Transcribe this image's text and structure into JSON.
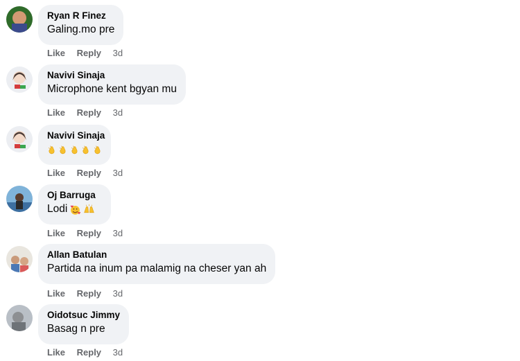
{
  "comments": [
    {
      "name": "Ryan R Finez",
      "text": "Galing.mo pre",
      "actions": {
        "like": "Like",
        "reply": "Reply",
        "time": "3d"
      }
    },
    {
      "name": "Navivi Sinaja",
      "text": "Microphone kent bgyan mu",
      "actions": {
        "like": "Like",
        "reply": "Reply",
        "time": "3d"
      }
    },
    {
      "name": "Navivi Sinaja",
      "text": "",
      "emoji": [
        "clapping-hands",
        "clapping-hands",
        "clapping-hands",
        "clapping-hands",
        "clapping-hands"
      ],
      "actions": {
        "like": "Like",
        "reply": "Reply",
        "time": "3d"
      }
    },
    {
      "name": "Oj Barruga",
      "text": "Lodi",
      "emoji": [
        "smiling-face-with-hearts",
        "raising-hands"
      ],
      "actions": {
        "like": "Like",
        "reply": "Reply",
        "time": "3d"
      }
    },
    {
      "name": "Allan Batulan",
      "text": "Partida na inum pa malamig na cheser yan ah",
      "actions": {
        "like": "Like",
        "reply": "Reply",
        "time": "3d"
      }
    },
    {
      "name": "Oidotsuc Jimmy",
      "text": "Basag n pre",
      "actions": {
        "like": "Like",
        "reply": "Reply",
        "time": "3d"
      }
    }
  ],
  "colors": {
    "bubble": "#f0f2f5",
    "text": "#050505",
    "meta": "#65676b"
  }
}
